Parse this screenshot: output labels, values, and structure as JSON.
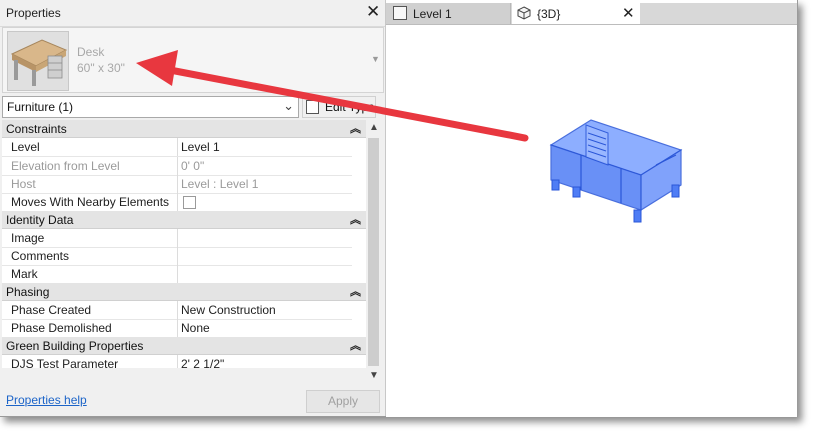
{
  "properties": {
    "title": "Properties",
    "type_name": "Desk",
    "type_size": "60\" x 30\"",
    "filter_value": "Furniture (1)",
    "edit_type_label": "Edit Type",
    "groups": {
      "constraints": "Constraints",
      "identity": "Identity Data",
      "phasing": "Phasing",
      "green": "Green Building Properties"
    },
    "rows": {
      "level": {
        "label": "Level",
        "value": "Level 1"
      },
      "elevation": {
        "label": "Elevation from Level",
        "value": "0'  0\""
      },
      "host": {
        "label": "Host",
        "value": "Level : Level 1"
      },
      "moves": {
        "label": "Moves With Nearby Elements",
        "value": ""
      },
      "image": {
        "label": "Image",
        "value": ""
      },
      "comments": {
        "label": "Comments",
        "value": ""
      },
      "mark": {
        "label": "Mark",
        "value": ""
      },
      "phase_created": {
        "label": "Phase Created",
        "value": "New Construction"
      },
      "phase_demolished": {
        "label": "Phase Demolished",
        "value": "None"
      },
      "djs": {
        "label": "DJS Test Parameter",
        "value": "2'  2 1/2\""
      }
    },
    "help_link": "Properties help",
    "apply_label": "Apply"
  },
  "tabs": [
    {
      "label": "Level 1"
    },
    {
      "label": "{3D}"
    }
  ],
  "icons": [
    "close-icon",
    "dropdown-arrow-icon",
    "edit-type-icon",
    "collapse-icon",
    "scroll-up-icon",
    "scroll-down-icon",
    "floor-plan-icon",
    "3d-view-icon"
  ],
  "colors": {
    "model_blue": "#3c6ff2",
    "annotation_arrow": "#e8373f",
    "link": "#1c64c8"
  }
}
